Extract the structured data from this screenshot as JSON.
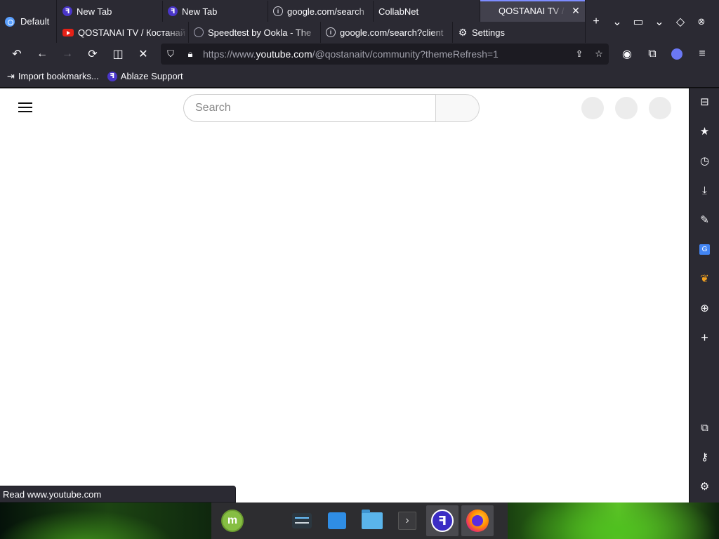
{
  "browser": {
    "workspace_label": "Default",
    "tabs_row1": [
      {
        "label": "New Tab",
        "favicon": "ablaze-favicon"
      },
      {
        "label": "New Tab",
        "favicon": "ablaze-favicon"
      },
      {
        "label": "google.com/search",
        "favicon": "info-icon"
      },
      {
        "label": "CollabNet",
        "favicon": ""
      },
      {
        "label": "QOSTANAI TV / ",
        "favicon": "",
        "active": true
      }
    ],
    "tabs_row2": [
      {
        "label": "QOSTANAI TV / Костанай",
        "favicon": "youtube-favicon"
      },
      {
        "label": "Speedtest by Ookla - The",
        "favicon": "speedtest-favicon"
      },
      {
        "label": "google.com/search?client",
        "favicon": "info-icon"
      },
      {
        "label": "Settings",
        "favicon": "gear-icon"
      }
    ],
    "url": {
      "prefix": "https://www.",
      "host": "youtube.com",
      "path": "/@qostanaitv/community?themeRefresh=1"
    },
    "bookmarks": [
      {
        "label": "Import bookmarks...",
        "icon": "import-icon"
      },
      {
        "label": "Ablaze Support",
        "icon": "ablaze-favicon"
      }
    ],
    "status_text": "Read www.youtube.com"
  },
  "page": {
    "search_placeholder": "Search"
  },
  "sidebar_icons": [
    "toolbox-icon",
    "star-icon",
    "history-icon",
    "download-icon",
    "pen-icon",
    "translate-icon",
    "leaf-icon",
    "globe-icon",
    "plus-icon",
    "extension-icon",
    "key-icon",
    "gear-icon"
  ],
  "taskbar_items": [
    "linux-mint-menu-icon",
    "system-settings-icon",
    "software-store-icon",
    "files-icon",
    "terminal-icon",
    "ablaze-browser-icon",
    "firefox-icon"
  ],
  "colors": {
    "chrome_bg": "#2b2a33",
    "active_tab": "#42414d",
    "accent": "#7d8cff"
  }
}
